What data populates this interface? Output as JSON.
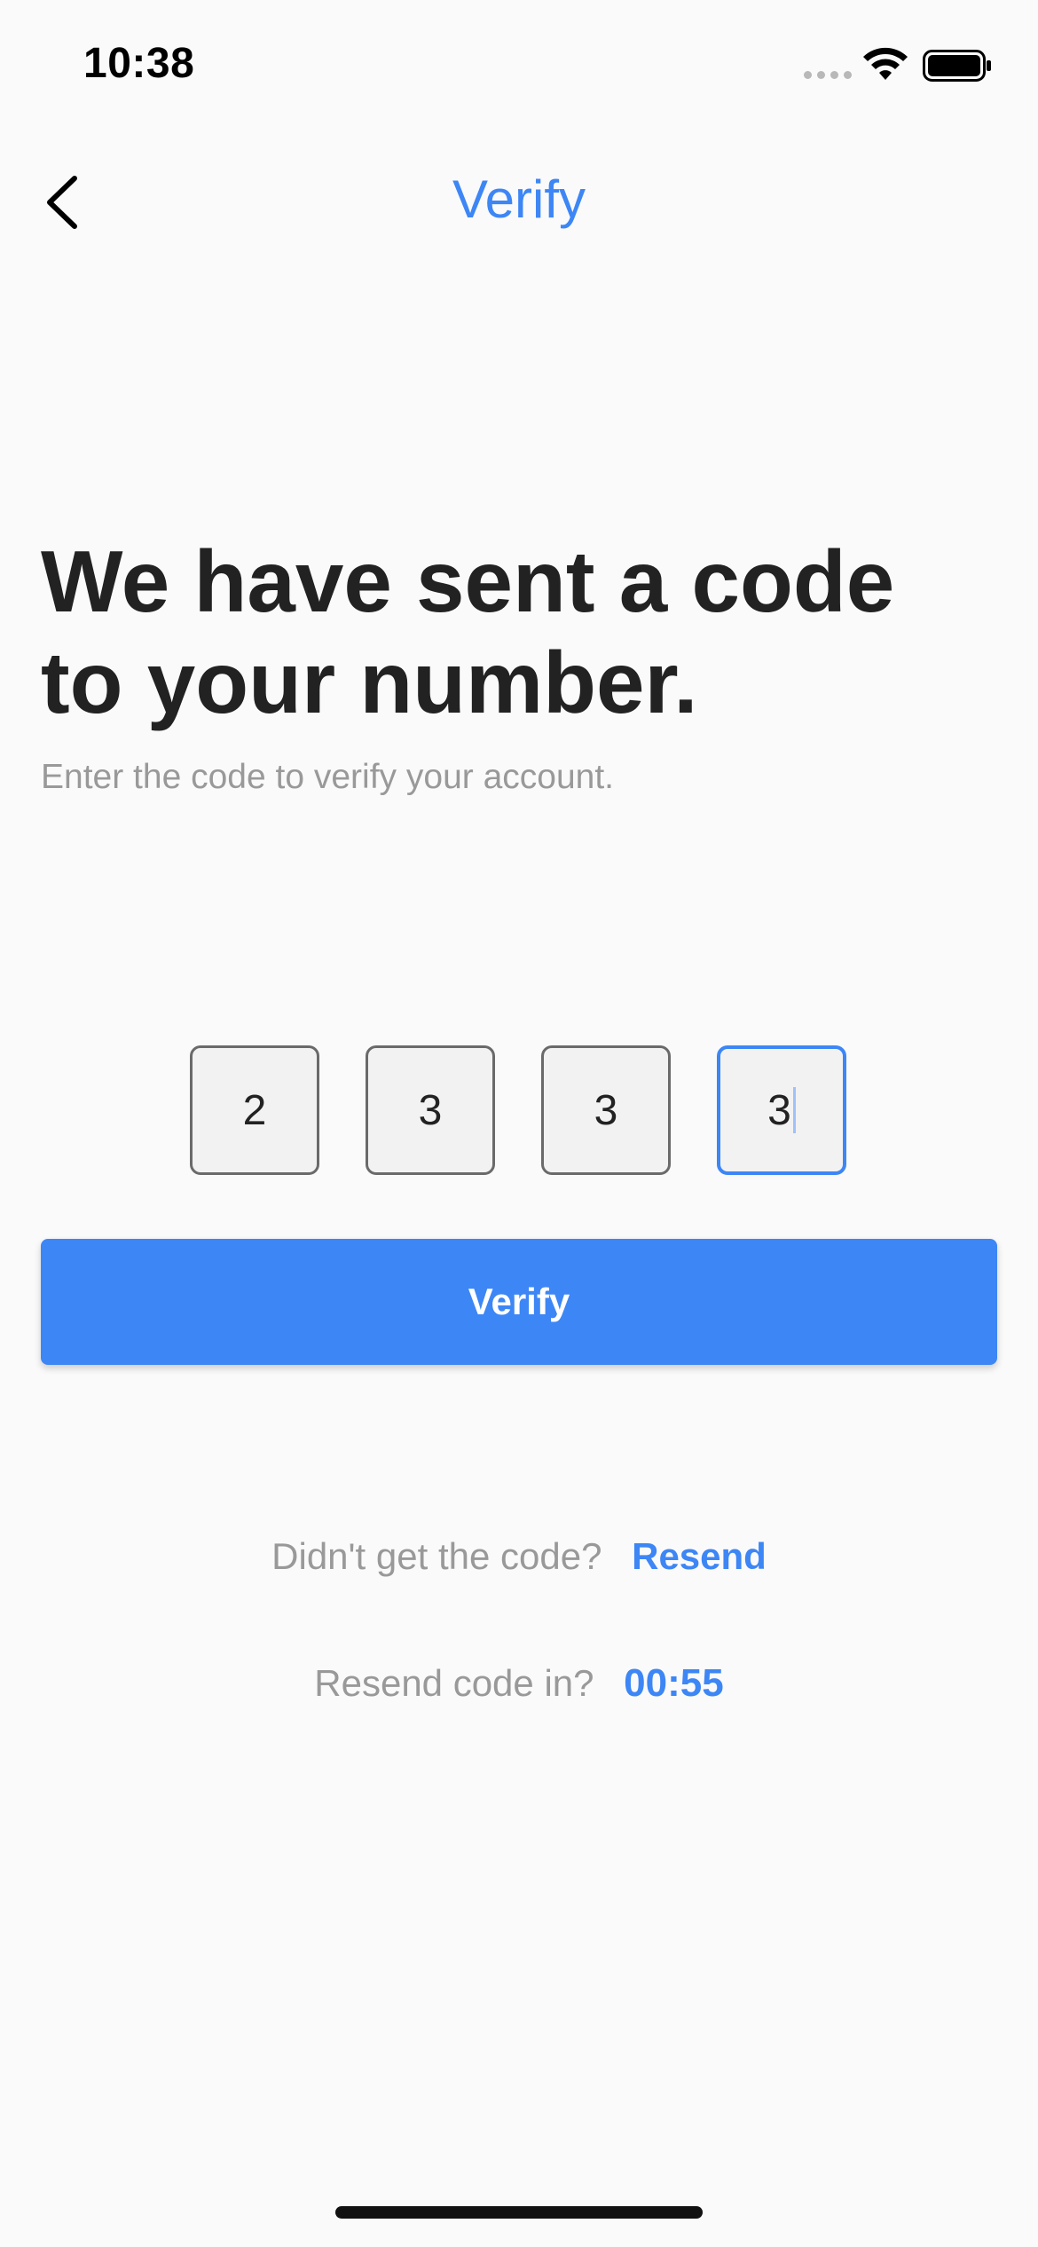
{
  "status_bar": {
    "time": "10:38"
  },
  "nav": {
    "title": "Verify",
    "back_icon": "chevron-left-icon"
  },
  "content": {
    "headline_line1": "We have sent a code",
    "headline_line2": "to your number.",
    "subtitle": "Enter the code to verify your account."
  },
  "code_inputs": [
    {
      "value": "2",
      "active": false
    },
    {
      "value": "3",
      "active": false
    },
    {
      "value": "3",
      "active": false
    },
    {
      "value": "3",
      "active": true
    }
  ],
  "verify_button": {
    "label": "Verify"
  },
  "resend": {
    "prompt": "Didn't get the code?",
    "link_label": "Resend"
  },
  "timer": {
    "prompt": "Resend code in?",
    "value": "00:55"
  },
  "colors": {
    "accent": "#3d86f5",
    "text_primary": "#222222",
    "text_muted": "#999999",
    "background": "#fafafa"
  }
}
